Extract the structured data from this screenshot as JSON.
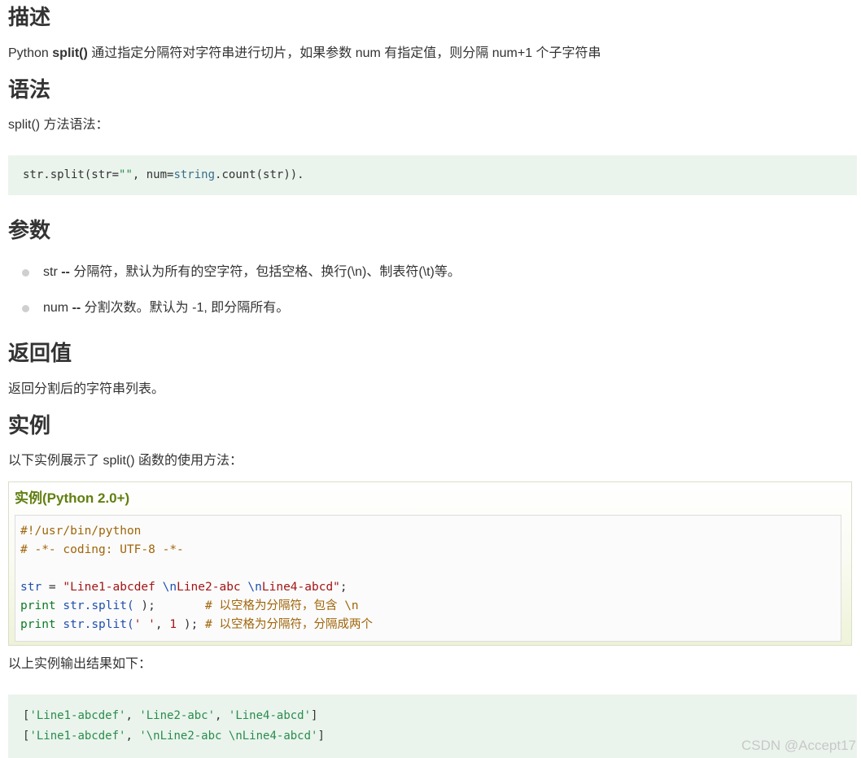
{
  "sections": {
    "description": {
      "heading": "描述",
      "text_prefix": "Python ",
      "text_bold": "split()",
      "text_suffix": " 通过指定分隔符对字符串进行切片，如果参数 num 有指定值，则分隔 num+1 个子字符串"
    },
    "syntax": {
      "heading": "语法",
      "intro": "split() 方法语法：",
      "code": {
        "part1": "str.split(str=",
        "part2": "\"\"",
        "part3": ", num=",
        "part4": "string",
        "part5": ".count(str))."
      }
    },
    "params": {
      "heading": "参数",
      "items": [
        {
          "name": "str",
          "sep": " -- ",
          "desc": "分隔符，默认为所有的空字符，包括空格、换行(\\n)、制表符(\\t)等。"
        },
        {
          "name": "num",
          "sep": " -- ",
          "desc": "分割次数。默认为 -1, 即分隔所有。"
        }
      ]
    },
    "return_value": {
      "heading": "返回值",
      "text": "返回分割后的字符串列表。"
    },
    "example": {
      "heading": "实例",
      "intro": "以下实例展示了 split() 函数的使用方法：",
      "box_title": "实例(Python 2.0+)",
      "lines": {
        "l1": "#!/usr/bin/python",
        "l2": "# -*- coding: UTF-8 -*-",
        "l4_var": "str",
        "l4_eq": " = ",
        "l4_s1": "\"Line1-abcdef ",
        "l4_e1": "\\n",
        "l4_s2": "Line2-abc ",
        "l4_e2": "\\n",
        "l4_s3": "Line4-abcd\"",
        "l4_end": ";",
        "l5_print": "print",
        "l5_sp": " ",
        "l5_var": "str",
        "l5_call": ".split(",
        "l5_rest": " );       ",
        "l5_comment": "# 以空格为分隔符，包含 \\n",
        "l6_print": "print",
        "l6_sp": " ",
        "l6_var": "str",
        "l6_call": ".split(",
        "l6_str": "' '",
        "l6_comma": ", ",
        "l6_num": "1",
        "l6_rest": " ); ",
        "l6_comment": "# 以空格为分隔符，分隔成两个"
      },
      "output_intro": "以上实例输出结果如下：",
      "output": {
        "o1_a": "[",
        "o1_b": "'Line1-abcdef'",
        "o1_c": ", ",
        "o1_d": "'Line2-abc'",
        "o1_e": ", ",
        "o1_f": "'Line4-abcd'",
        "o1_g": "]",
        "o2_a": "[",
        "o2_b": "'Line1-abcdef'",
        "o2_c": ", ",
        "o2_d": "'\\nLine2-abc \\nLine4-abcd'",
        "o2_e": "]"
      }
    }
  },
  "watermark": "CSDN @Accept17"
}
